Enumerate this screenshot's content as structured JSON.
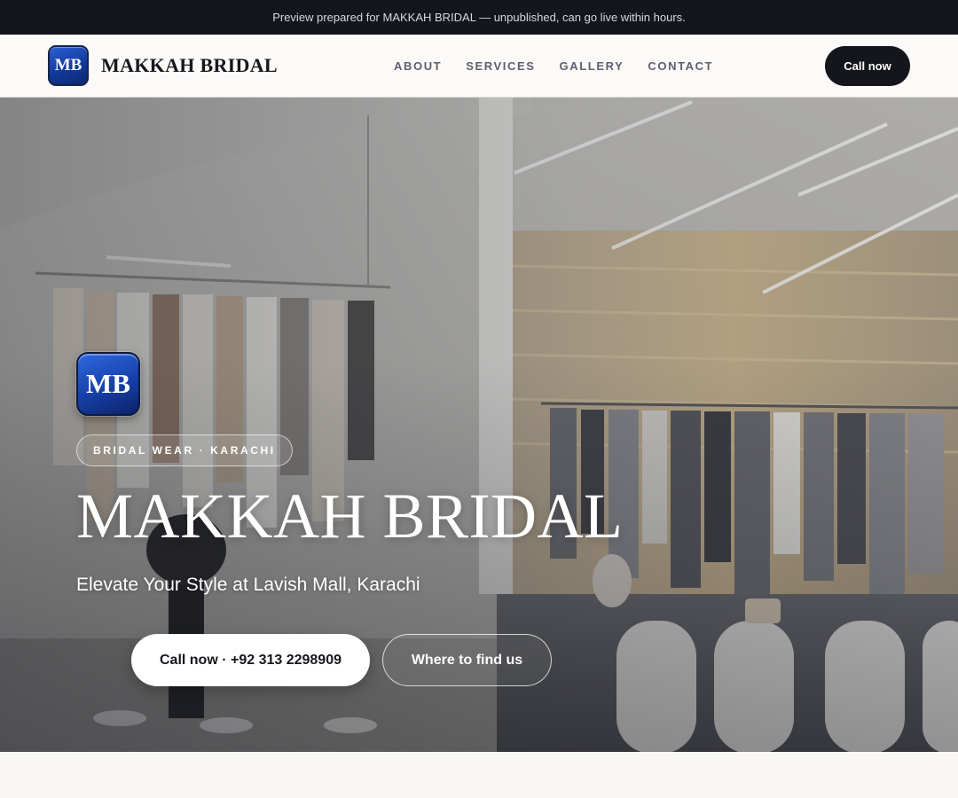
{
  "announcement": "Preview prepared for MAKKAH BRIDAL — unpublished, can go live within hours.",
  "header": {
    "logo_initials": "MB",
    "brand_name": "MAKKAH BRIDAL",
    "nav": [
      "ABOUT",
      "SERVICES",
      "GALLERY",
      "CONTACT"
    ],
    "cta_label": "Call now"
  },
  "hero": {
    "logo_initials": "MB",
    "tag": "BRIDAL WEAR · KARACHI",
    "title": "MAKKAH BRIDAL",
    "subtitle": "Elevate Your Style at Lavish Mall, Karachi",
    "primary_cta": "Call now · +92 313 2298909",
    "secondary_cta": "Where to find us",
    "background_image": "boutique-interior-photo"
  },
  "colors": {
    "dark": "#14161c",
    "logo_blue": "#1640a8",
    "page_bg": "#f8f7f4"
  }
}
